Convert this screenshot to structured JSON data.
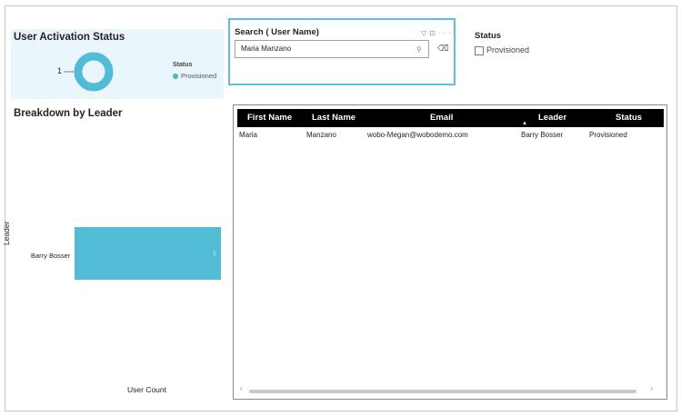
{
  "activation": {
    "title": "User Activation Status",
    "donut_value": "1",
    "legend_title": "Status",
    "legend_item": "Provisioned",
    "accent_color": "#47b8d4"
  },
  "search": {
    "title": "Search ( User Name)",
    "value": "Maria Manzano",
    "icons": [
      "filter-icon",
      "focus-mode-icon",
      "more-options-icon",
      "search-icon",
      "eraser-icon"
    ]
  },
  "status_slicer": {
    "title": "Status",
    "option": "Provisioned",
    "checked": false
  },
  "breakdown": {
    "title": "Breakdown by Leader",
    "y_axis_title": "Leader",
    "x_axis_title": "User Count",
    "chart_data": {
      "type": "bar",
      "orientation": "horizontal",
      "categories": [
        "Barry Bosser"
      ],
      "values": [
        1
      ],
      "bar_color": "#52bcd6"
    },
    "bar_label": "1"
  },
  "table": {
    "columns": [
      "First Name",
      "Last Name",
      "Email",
      "Leader",
      "Status"
    ],
    "sorted_column": "Leader",
    "rows": [
      {
        "first": "Maria",
        "last": "Manzano",
        "email": "wobo-Megan@wobodemo.com",
        "leader": "Barry Bosser",
        "status": "Provisioned"
      }
    ]
  }
}
